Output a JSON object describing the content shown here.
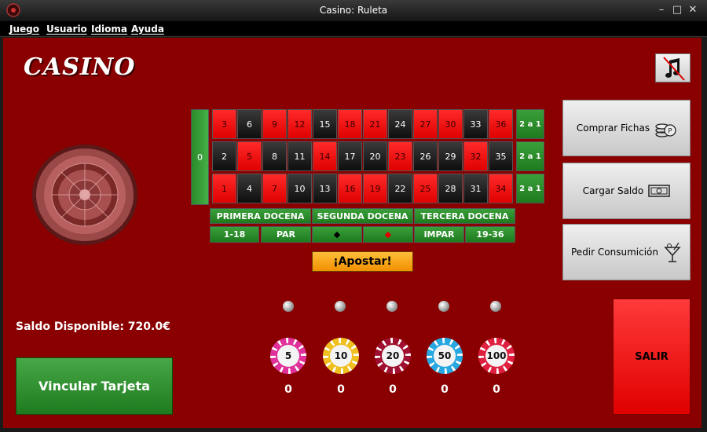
{
  "window": {
    "title": "Casino: Ruleta",
    "minimize": "–",
    "maximize": "□",
    "close": "✕"
  },
  "menu": [
    "Juego",
    "Usuario",
    "Idioma",
    "Ayuda"
  ],
  "logo": "CASINO",
  "music_icon": "music-muted-icon",
  "table": {
    "zero": "0",
    "top_row": [
      "3",
      "6",
      "9",
      "12",
      "15",
      "18",
      "21",
      "24",
      "27",
      "30",
      "33",
      "36"
    ],
    "mid_row": [
      "2",
      "5",
      "8",
      "11",
      "14",
      "17",
      "20",
      "23",
      "26",
      "29",
      "32",
      "35"
    ],
    "bot_row": [
      "1",
      "4",
      "7",
      "10",
      "13",
      "16",
      "19",
      "22",
      "25",
      "28",
      "31",
      "34"
    ],
    "columns": [
      "2 a 1",
      "2 a 1",
      "2 a 1"
    ],
    "dozens": [
      "PRIMERA DOCENA",
      "SEGUNDA DOCENA",
      "TERCERA DOCENA"
    ],
    "outside": [
      "1-18",
      "PAR",
      "◆",
      "◆",
      "IMPAR",
      "19-36"
    ]
  },
  "bet_button": "¡Apostar!",
  "side_buttons": {
    "buy_chips": "Comprar Fichas",
    "load_balance": "Cargar Saldo",
    "order_drink": "Pedir Consumición"
  },
  "exit_button": "SALIR",
  "balance": "Saldo Disponible: 720.0€",
  "link_card_button": "Vincular Tarjeta",
  "chips": [
    {
      "value": "5",
      "count": "0",
      "color": "#e0309a"
    },
    {
      "value": "10",
      "count": "0",
      "color": "#f0c020"
    },
    {
      "value": "20",
      "count": "0",
      "color": "#a01030"
    },
    {
      "value": "50",
      "count": "0",
      "color": "#28a8e0"
    },
    {
      "value": "100",
      "count": "0",
      "color": "#e02040"
    }
  ],
  "colors": {
    "felt": "#8a0000",
    "red": "#e00000",
    "green": "#1e7a1e",
    "gold": "#f09000"
  }
}
